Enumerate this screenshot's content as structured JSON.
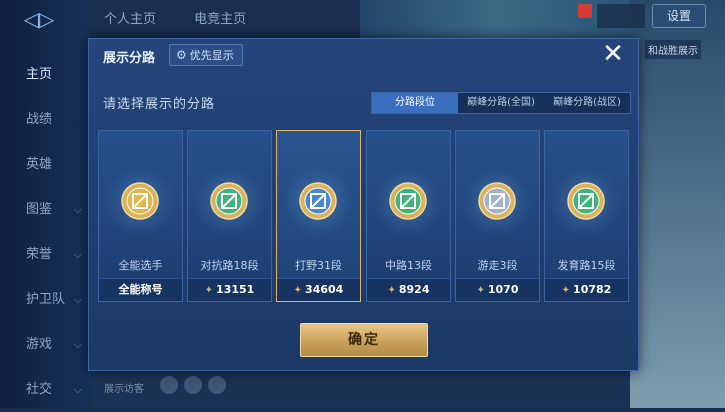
{
  "background": {
    "tabs": [
      "个人主页",
      "电竞主页"
    ],
    "settings_label": "设置",
    "right_hint": "和战胜展示",
    "bottom_hint": "展示访客"
  },
  "sidebar": {
    "items": [
      {
        "label": "主页",
        "active": true
      },
      {
        "label": "战绩"
      },
      {
        "label": "英雄"
      },
      {
        "label": "图鉴"
      },
      {
        "label": "荣誉"
      },
      {
        "label": "护卫队"
      },
      {
        "label": "游戏"
      },
      {
        "label": "社交"
      }
    ]
  },
  "dialog": {
    "title": "展示分路",
    "pref_label": "优先显示",
    "close_symbol": "✕",
    "prompt": "请选择展示的分路",
    "seg_tabs": [
      {
        "label": "分路段位",
        "active": true
      },
      {
        "label": "巅峰分路(全国)"
      },
      {
        "label": "巅峰分路(战区)"
      }
    ],
    "cards": [
      {
        "name": "全能选手",
        "foot": "全能称号",
        "icon": "all-round-badge-icon",
        "color": "#e7b64a",
        "selected": false,
        "points": false
      },
      {
        "name": "对抗路18段",
        "foot": "13151",
        "icon": "clash-lane-badge-icon",
        "color": "#3fb57c",
        "selected": false,
        "points": true
      },
      {
        "name": "打野31段",
        "foot": "34604",
        "icon": "jungle-badge-icon",
        "color": "#4a86d8",
        "selected": true,
        "points": true
      },
      {
        "name": "中路13段",
        "foot": "8924",
        "icon": "mid-lane-badge-icon",
        "color": "#3fb57c",
        "selected": false,
        "points": true
      },
      {
        "name": "游走3段",
        "foot": "1070",
        "icon": "roam-badge-icon",
        "color": "#9fb4cc",
        "selected": false,
        "points": true
      },
      {
        "name": "发育路15段",
        "foot": "10782",
        "icon": "farm-lane-badge-icon",
        "color": "#3fb57c",
        "selected": false,
        "points": true
      }
    ],
    "confirm_label": "确定"
  }
}
